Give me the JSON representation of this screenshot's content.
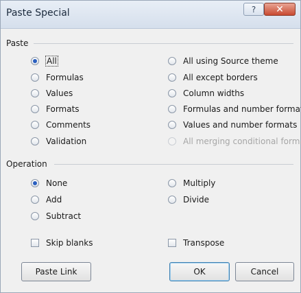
{
  "window": {
    "title": "Paste Special"
  },
  "titlebar": {
    "help_icon": "?",
    "close_icon": "✕"
  },
  "paste": {
    "label": "Paste",
    "selected": "All",
    "left_options": [
      "All",
      "Formulas",
      "Values",
      "Formats",
      "Comments",
      "Validation"
    ],
    "right_options": [
      "All using Source theme",
      "All except borders",
      "Column widths",
      "Formulas and number formats",
      "Values and number formats",
      "All merging conditional formats"
    ],
    "disabled": [
      "All merging conditional formats"
    ]
  },
  "operation": {
    "label": "Operation",
    "selected": "None",
    "left_options": [
      "None",
      "Add",
      "Subtract"
    ],
    "right_options": [
      "Multiply",
      "Divide"
    ]
  },
  "checks": {
    "skip_blanks": "Skip blanks",
    "transpose": "Transpose"
  },
  "buttons": {
    "paste_link": "Paste Link",
    "ok": "OK",
    "cancel": "Cancel"
  },
  "colors": {
    "accent": "#2a5fbf",
    "close": "#c84a31",
    "window_bg": "#f0f0f0"
  }
}
